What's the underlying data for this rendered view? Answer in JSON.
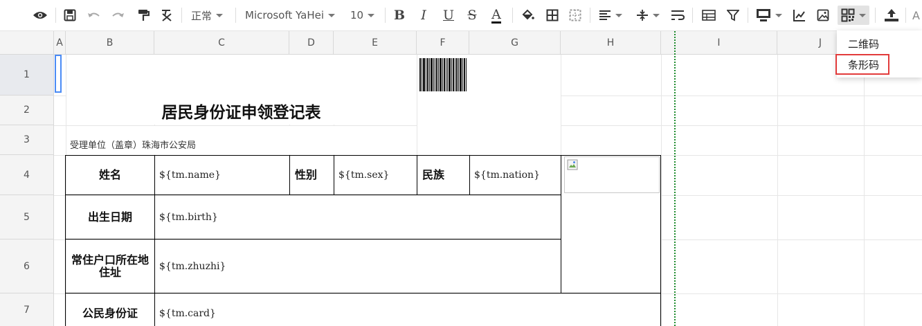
{
  "toolbar": {
    "font_style": "正常",
    "font_family": "Microsoft YaHei",
    "font_size": "10",
    "bold": "B",
    "italic": "I",
    "underline": "U",
    "strike": "S",
    "font_color": "A",
    "cut_label": "A"
  },
  "columns": [
    "A",
    "B",
    "C",
    "D",
    "E",
    "F",
    "G",
    "H",
    "I",
    "J"
  ],
  "rows": [
    "1",
    "2",
    "3",
    "4",
    "5",
    "6",
    "7"
  ],
  "sheet": {
    "title": "居民身份证申领登记表",
    "subtitle": "受理单位（盖章）珠海市公安局",
    "labels": {
      "name": "姓名",
      "sex": "性别",
      "nation": "民族",
      "birth": "出生日期",
      "address": "常住户口所在地住址",
      "card": "公民身份证"
    },
    "values": {
      "name": "${tm.name}",
      "sex": "${tm.sex}",
      "nation": "${tm.nation}",
      "birth": "${tm.birth}",
      "address": "${tm.zhuzhi}",
      "card": "${tm.card}"
    }
  },
  "dropdown_menu": {
    "items": [
      "二维码",
      "条形码"
    ],
    "highlighted": "条形码"
  },
  "colors": {
    "selection": "#4a8bf5",
    "highlight_border": "#e23b3b",
    "page_break": "#1a8a2a"
  }
}
